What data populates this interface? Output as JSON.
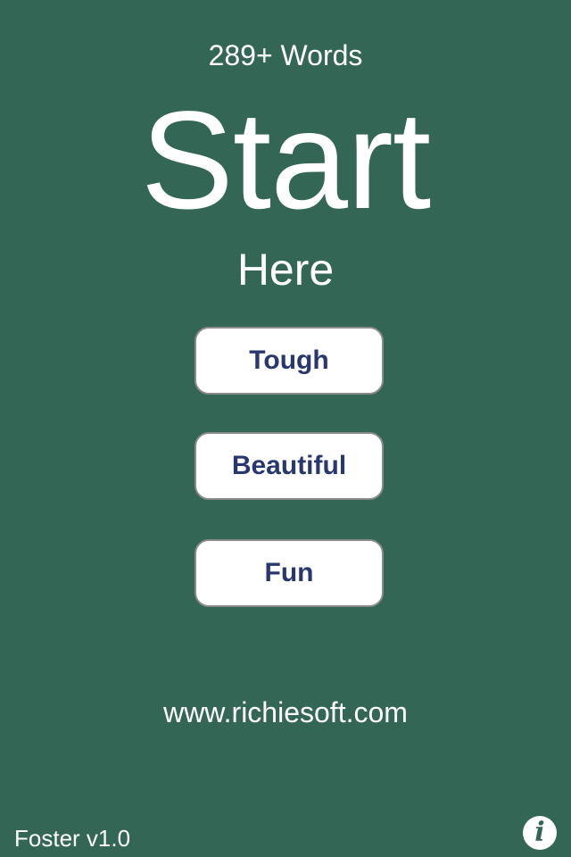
{
  "header": {
    "word_count": "289+ Words",
    "title": "Start",
    "subtitle": "Here"
  },
  "modes": {
    "tough": "Tough",
    "beautiful": "Beautiful",
    "fun": "Fun"
  },
  "footer": {
    "website": "www.richiesoft.com",
    "version": "Foster v1.0",
    "info_glyph": "i"
  },
  "colors": {
    "background": "#336655",
    "button_text": "#28386e",
    "button_bg": "#ffffff",
    "text": "#ffffff"
  },
  "icons": {
    "info": "info-icon"
  }
}
